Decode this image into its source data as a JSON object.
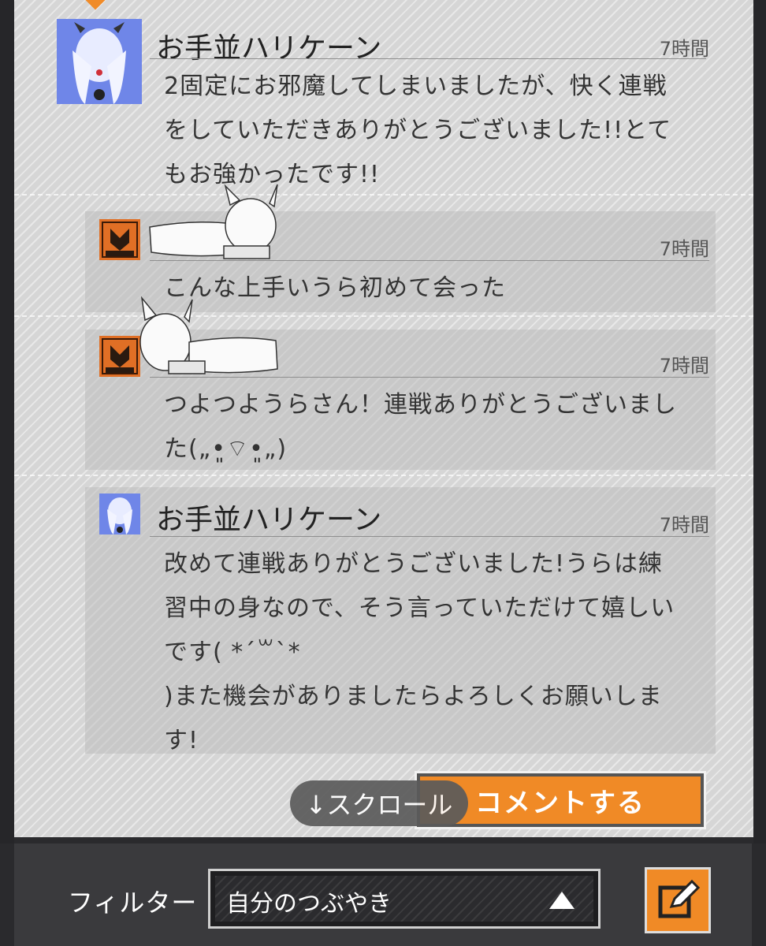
{
  "posts": [
    {
      "author": "お手並ハリケーン",
      "time": "7時間",
      "text": "2固定にお邪魔してしまいましたが、快く連戦\nをしていただきありがとうございました!!とて\nもお強かったです!!"
    },
    {
      "author": "",
      "time": "7時間",
      "text": "こんな上手いうら初めて会った"
    },
    {
      "author": "",
      "time": "7時間",
      "text": "つよつようらさん！連戦ありがとうございまし\nた(„•͈⌔•͈„)"
    },
    {
      "author": "お手並ハリケーン",
      "time": "7時間",
      "text": "改めて連戦ありがとうございました!うらは練\n習中の身なので、そう言っていただけて嬉しい\nです( *´꒳`*\n)また機会がありましたらよろしくお願いしま\nす!"
    }
  ],
  "scroll_label": "↓スクロール",
  "comment_button": "コメントする",
  "filter": {
    "label": "フィルター",
    "value": "自分のつぶやき"
  },
  "colors": {
    "accent": "#f08a26",
    "panel": "#d6d6d6",
    "avatar_blue": "#6f86e8",
    "avatar_orange": "#e06f25"
  },
  "icons": [
    "dropdown-arrow-icon",
    "edit-icon"
  ]
}
